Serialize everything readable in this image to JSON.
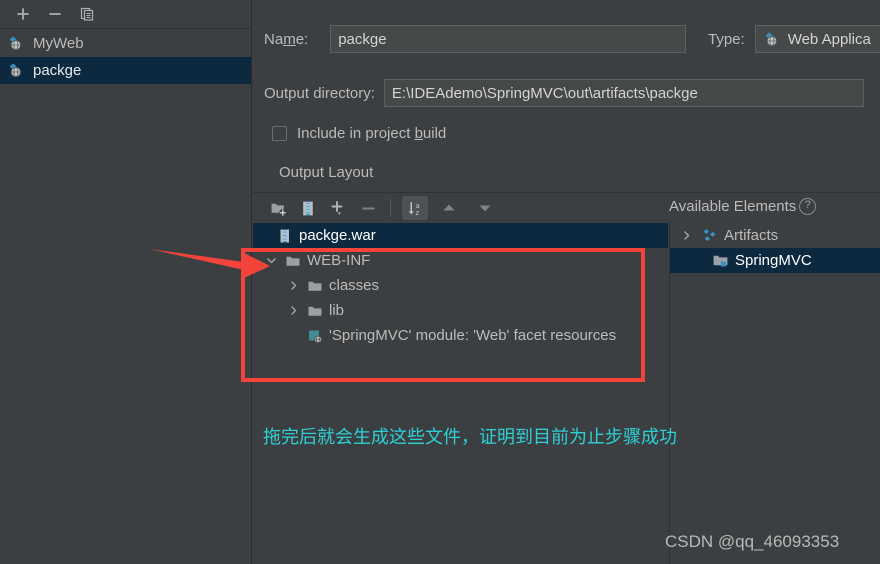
{
  "sidebar": {
    "toolbar": [
      {
        "name": "add-artifact-button",
        "icon": "plus-icon",
        "label": "+"
      },
      {
        "name": "remove-artifact-button",
        "icon": "minus-icon",
        "label": "−"
      },
      {
        "name": "copy-artifact-button",
        "icon": "copy-icon",
        "label": "copy"
      }
    ],
    "items": [
      {
        "label": "MyWeb",
        "icon": "web-application-icon",
        "selected": false
      },
      {
        "label": "packge",
        "icon": "web-application-icon",
        "selected": true
      }
    ]
  },
  "form": {
    "name_label": "Name:",
    "name_label_pre": "Na",
    "name_label_mnemonic": "m",
    "name_label_post": "e:",
    "name_value": "packge",
    "name_placeholder": "",
    "type_label": "Type:",
    "type_value": "Web Applica",
    "type_icon": "web-application-icon",
    "output_dir_label": "Output directory:",
    "output_dir_value": "E:\\IDEAdemo\\SpringMVC\\out\\artifacts\\packge",
    "output_dir_placeholder": "",
    "include_in_build_pre": "Include in project ",
    "include_in_build_mnemonic": "b",
    "include_in_build_post": "uild",
    "include_in_build_checked": false,
    "output_layout_label": "Output Layout"
  },
  "layout_toolbar": {
    "buttons": [
      {
        "name": "add-directory-button",
        "icon": "folder-add-icon",
        "active": false
      },
      {
        "name": "add-archive-button",
        "icon": "archive-jar-icon",
        "active": false
      },
      {
        "name": "add-element-button",
        "icon": "plus-dropdown-icon",
        "active": false
      },
      {
        "name": "remove-element-button",
        "icon": "minus-icon",
        "active": false
      },
      {
        "name": "sort-alphabetically-button",
        "icon": "sort-az-icon",
        "active": true
      },
      {
        "name": "move-up-button",
        "icon": "arrow-up-icon",
        "active": false
      },
      {
        "name": "move-down-button",
        "icon": "arrow-down-icon",
        "active": false
      }
    ],
    "available_elements_label": "Available Elements",
    "help_glyph": "?"
  },
  "output_tree": [
    {
      "label": "packge.war",
      "icon": "war-archive-icon",
      "indent": 0,
      "twisty": "none",
      "selected": true
    },
    {
      "label": "WEB-INF",
      "icon": "folder-icon",
      "indent": 1,
      "twisty": "expanded",
      "selected": false
    },
    {
      "label": "classes",
      "icon": "folder-icon",
      "indent": 2,
      "twisty": "collapsed",
      "selected": false
    },
    {
      "label": "lib",
      "icon": "folder-icon",
      "indent": 2,
      "twisty": "collapsed",
      "selected": false
    },
    {
      "label": "'SpringMVC' module: 'Web' facet resources",
      "icon": "web-facet-icon",
      "indent": 2,
      "twisty": "none",
      "selected": false
    }
  ],
  "available_tree": [
    {
      "label": "Artifacts",
      "icon": "artifacts-icon",
      "indent": 0,
      "twisty": "collapsed",
      "selected": false
    },
    {
      "label": "SpringMVC",
      "icon": "module-folder-icon",
      "indent": 1,
      "twisty": "none",
      "selected": true
    }
  ],
  "annotations": {
    "note_text": "拖完后就会生成这些文件，证明到目前为止步骤成功",
    "note_color": "#2ed0d6",
    "highlight_color": "#f4433b",
    "watermark": "CSDN @qq_46093353"
  },
  "colors": {
    "background": "#3c3f41",
    "selection": "#0d293f",
    "field_background": "#45494a",
    "text": "#bbbbbb",
    "accent_blue": "#3592c4"
  }
}
